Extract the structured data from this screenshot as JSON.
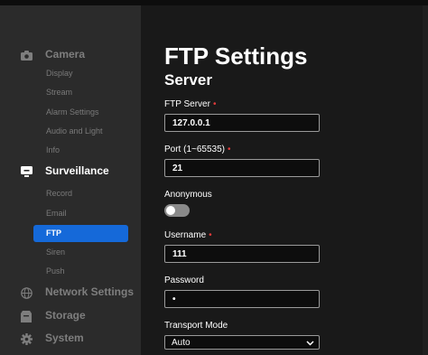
{
  "sidebar": {
    "groups": [
      {
        "label": "Camera",
        "icon": "camera-icon"
      },
      {
        "label": "Surveillance",
        "icon": "monitor-icon"
      },
      {
        "label": "Network Settings",
        "icon": "globe-icon"
      },
      {
        "label": "Storage",
        "icon": "storage-icon"
      },
      {
        "label": "System",
        "icon": "gear-icon"
      }
    ],
    "camera_items": [
      "Display",
      "Stream",
      "Alarm Settings",
      "Audio and Light",
      "Info"
    ],
    "surveillance_items": [
      "Record",
      "Email",
      "FTP",
      "Siren",
      "Push"
    ],
    "active_item": "FTP"
  },
  "main": {
    "title": "FTP Settings",
    "section": "Server",
    "fields": {
      "ftp_server": {
        "label": "FTP Server",
        "required": "•",
        "value": "127.0.0.1"
      },
      "port": {
        "label": "Port (1~65535)",
        "required": "•",
        "value": "21"
      },
      "anonymous": {
        "label": "Anonymous",
        "state": "off"
      },
      "username": {
        "label": "Username",
        "required": "•",
        "value": "111"
      },
      "password": {
        "label": "Password",
        "value": "•"
      },
      "transport_mode": {
        "label": "Transport Mode",
        "value": "Auto"
      }
    }
  },
  "colors": {
    "accent": "#1569d9",
    "required": "#e23b3b",
    "sidebar_bg": "#2b2b2b",
    "main_bg": "#191919"
  }
}
